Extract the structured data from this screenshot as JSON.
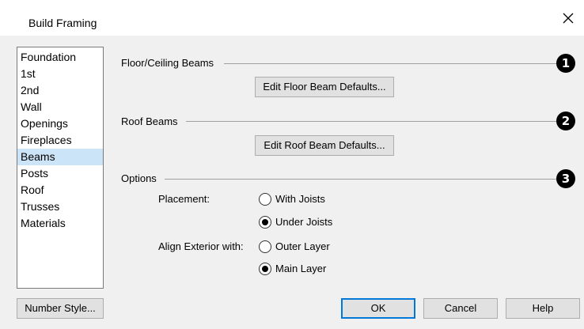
{
  "window": {
    "title": "Build Framing"
  },
  "sidebar": {
    "items": [
      {
        "label": "Foundation",
        "selected": false
      },
      {
        "label": "1st",
        "selected": false
      },
      {
        "label": "2nd",
        "selected": false
      },
      {
        "label": "Wall",
        "selected": false
      },
      {
        "label": "Openings",
        "selected": false
      },
      {
        "label": "Fireplaces",
        "selected": false
      },
      {
        "label": "Beams",
        "selected": true
      },
      {
        "label": "Posts",
        "selected": false
      },
      {
        "label": "Roof",
        "selected": false
      },
      {
        "label": "Trusses",
        "selected": false
      },
      {
        "label": "Materials",
        "selected": false
      }
    ]
  },
  "floor_ceiling": {
    "heading": "Floor/Ceiling Beams",
    "marker": "1",
    "button_label": "Edit Floor Beam Defaults..."
  },
  "roof": {
    "heading": "Roof Beams",
    "marker": "2",
    "button_label": "Edit Roof Beam Defaults..."
  },
  "options": {
    "heading": "Options",
    "marker": "3",
    "placement": {
      "label": "Placement:",
      "choices": [
        {
          "label": "With Joists",
          "checked": false
        },
        {
          "label": "Under Joists",
          "checked": true
        }
      ]
    },
    "align_exterior": {
      "label": "Align Exterior with:",
      "choices": [
        {
          "label": "Outer Layer",
          "checked": false
        },
        {
          "label": "Main Layer",
          "checked": true
        }
      ]
    }
  },
  "footer": {
    "number_style": "Number Style...",
    "ok": "OK",
    "cancel": "Cancel",
    "help": "Help"
  },
  "colors": {
    "selection": "#cce4f7",
    "default_button_border": "#0078d7",
    "marker": "#000000"
  }
}
